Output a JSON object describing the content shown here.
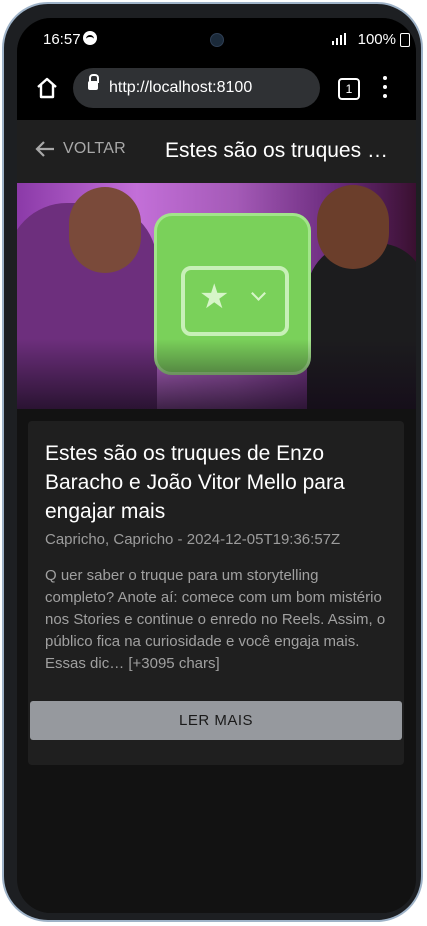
{
  "status_bar": {
    "time": "16:57",
    "battery": "100%",
    "icons": [
      "spotify-icon",
      "camera-icon",
      "signal-icon",
      "battery-icon"
    ]
  },
  "browser": {
    "url": "http://localhost:8100",
    "tab_count": "1",
    "icons": [
      "home-icon",
      "lock-icon",
      "tabs-icon",
      "more-vert-icon"
    ]
  },
  "toolbar": {
    "back_label": "VOLTAR",
    "title": "Estes são os truques de Enzo Baracho e João Vitor Mello para engajar mais"
  },
  "article": {
    "title": "Estes são os truques de Enzo Baracho e João Vitor Mello para engajar mais",
    "meta": "Capricho, Capricho - 2024-12-05T19:36:57Z",
    "summary": "Q uer saber o truque para um storytelling completo? Anote aí: comece com um bom mistério nos Stories e continue o enredo no Reels. Assim, o público fica na curiosidade e você engaja mais. Essas dic… [+3095 chars]",
    "read_more_label": "LER MAIS"
  },
  "colors": {
    "background": "#121212",
    "card": "#1f1f1f",
    "button": "#96999e",
    "hero_accent": "#7ad15a"
  }
}
